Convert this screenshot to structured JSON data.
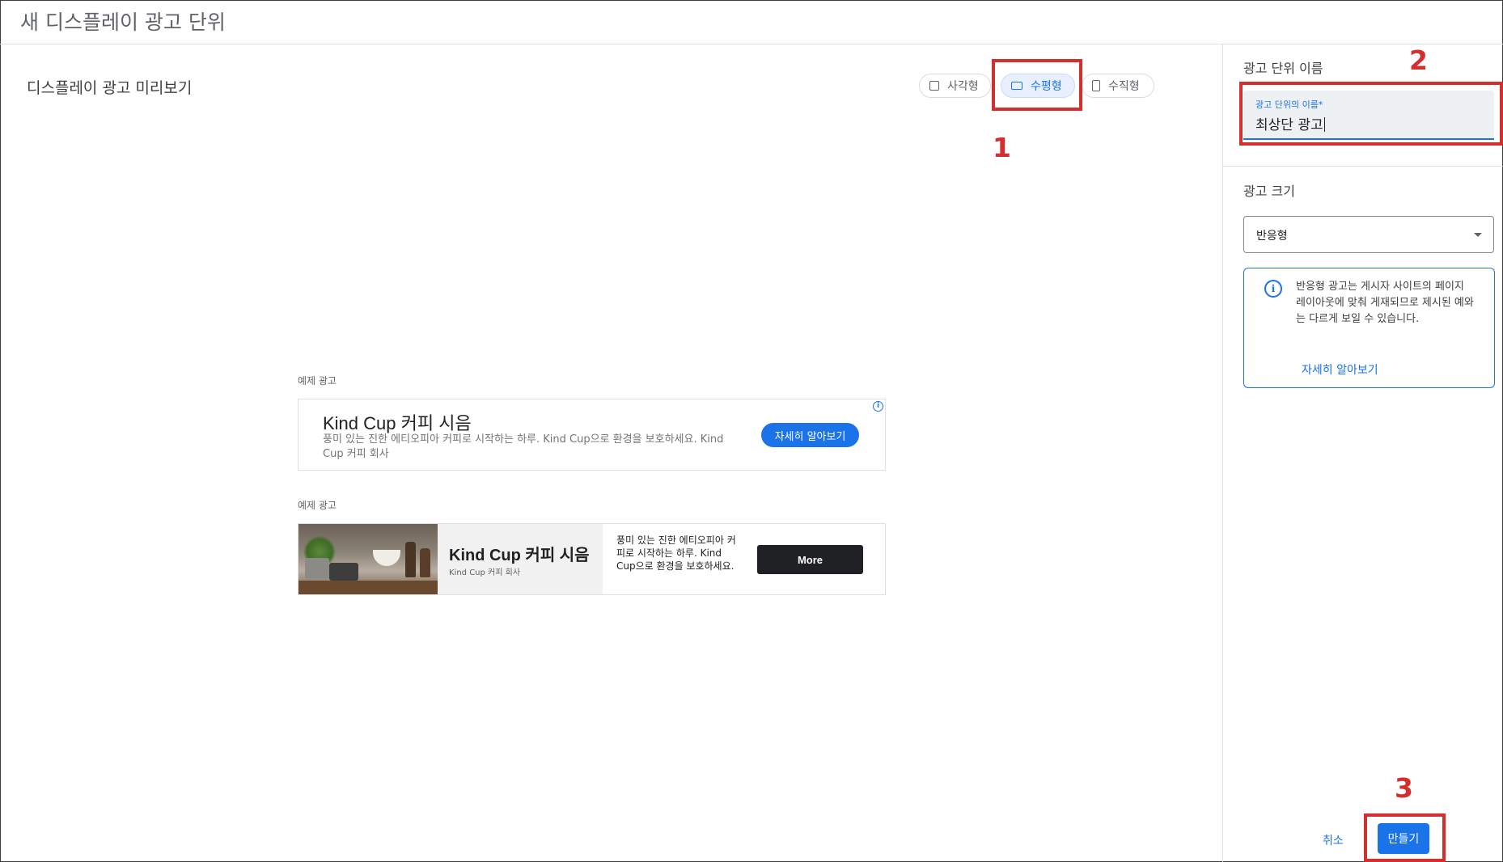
{
  "header": {
    "title": "새 디스플레이 광고 단위"
  },
  "preview": {
    "title": "디스플레이 광고 미리보기",
    "formats": [
      {
        "label": "사각형",
        "icon": "square-icon"
      },
      {
        "label": "수평형",
        "icon": "horizontal-rect-icon",
        "selected": true
      },
      {
        "label": "수직형",
        "icon": "vertical-rect-icon"
      }
    ],
    "example_label": "예제 광고",
    "ad1": {
      "title": "Kind Cup 커피 시음",
      "description": "풍미 있는 진한 에티오피아 커피로 시작하는 하루. Kind Cup으로 환경을 보호하세요. Kind Cup 커피 회사",
      "button": "자세히 알아보기",
      "info_icon": "i"
    },
    "ad2": {
      "title": "Kind Cup 커피 시음",
      "subtitle": "Kind Cup 커피 회사",
      "description": "풍미 있는 진한 에티오피아 커피로 시작하는 하루. Kind Cup으로 환경을 보호하세요.",
      "button": "More"
    }
  },
  "annotations": {
    "one": "1",
    "two": "2",
    "three": "3"
  },
  "sidebar": {
    "name_section_title": "광고 단위 이름",
    "name_field_label": "광고 단위의 이름*",
    "name_field_value": "최상단 광고",
    "size_section_title": "광고 크기",
    "size_value": "반응형",
    "info_text": "반응형 광고는 게시자 사이트의 페이지 레이아웃에 맞춰 게재되므로 제시된 예와는 다르게 보일 수 있습니다.",
    "info_link": "자세히 알아보기",
    "info_icon": "i"
  },
  "footer": {
    "cancel": "취소",
    "create": "만들기"
  },
  "colors": {
    "accent": "#1a73e8",
    "annotation": "#d32f2f"
  }
}
